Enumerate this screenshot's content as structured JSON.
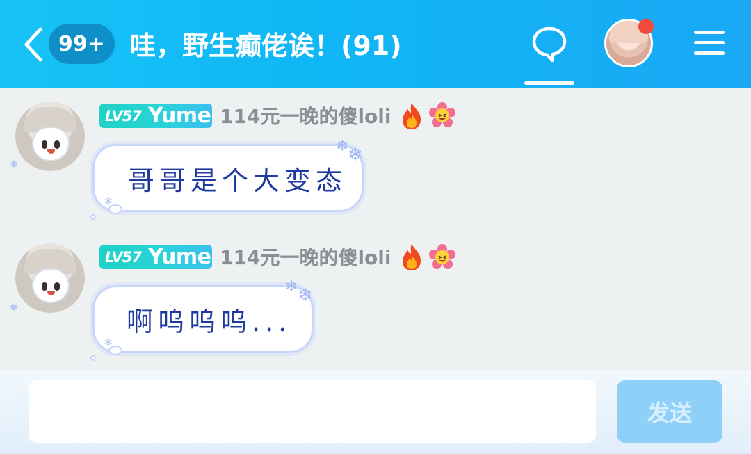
{
  "header": {
    "unread_count": "99+",
    "group_title": "哇，野生癫佬诶！(91)"
  },
  "messages": [
    {
      "level": "LV57",
      "username": "Yume",
      "nickname": "114元一晚的傻loli",
      "text": "哥哥是个大变态"
    },
    {
      "level": "LV57",
      "username": "Yume",
      "nickname": "114元一晚的傻loli",
      "text": "啊呜呜呜..."
    }
  ],
  "input": {
    "value": "",
    "send_label": "发送"
  },
  "colors": {
    "header_gradient_start": "#17c3f6",
    "header_gradient_end": "#1aa8f5",
    "bubble_text": "#1f3a9e",
    "level_tag": "#1fd2c4",
    "send_button": "#8fd0f9",
    "notify_dot": "#f24a3b"
  },
  "icons": {
    "back": "chevron-left-icon",
    "chat": "chat-bubble-icon",
    "menu": "hamburger-menu-icon",
    "badge_1": "fire-icon",
    "badge_2": "flower-emoji-icon"
  }
}
